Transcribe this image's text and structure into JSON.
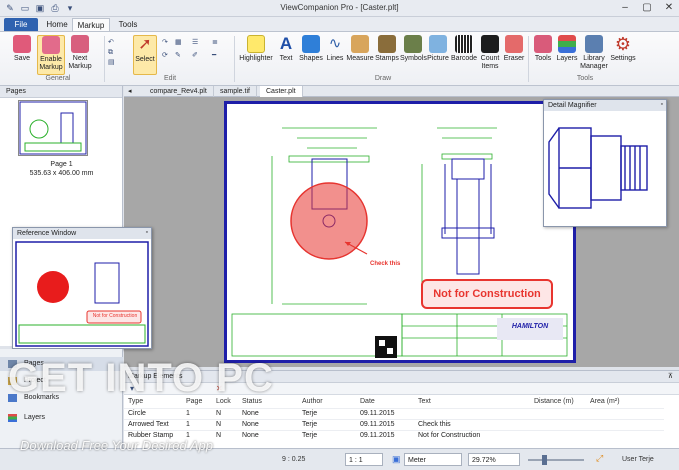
{
  "window": {
    "title": "ViewCompanion Pro - [Caster.plt]"
  },
  "tabs": {
    "file": "File",
    "home": "Home",
    "markup": "Markup",
    "tools": "Tools"
  },
  "ribbon": {
    "save": "Save",
    "enable_markup_1": "Enable",
    "enable_markup_2": "Markup",
    "next_markup_1": "Next",
    "next_markup_2": "Markup",
    "select": "Select",
    "highlighter": "Highlighter",
    "text": "Text",
    "shapes": "Shapes",
    "lines": "Lines",
    "measure": "Measure",
    "stamps": "Stamps",
    "symbols": "Symbols",
    "picture": "Picture",
    "barcode": "Barcode",
    "count_items_1": "Count",
    "count_items_2": "Items",
    "eraser": "Eraser",
    "tools": "Tools",
    "layers": "Layers",
    "library_manager_1": "Library",
    "library_manager_2": "Manager",
    "settings": "Settings",
    "group_general": "General",
    "group_edit": "Edit",
    "group_draw": "Draw",
    "group_tools": "Tools"
  },
  "pages_panel": {
    "title": "Pages",
    "page_label": "Page 1",
    "page_size": "535.63 x 406.00 mm"
  },
  "reference_window": {
    "title": "Reference Window",
    "stamp_text": "Not for Construction"
  },
  "doc_tabs": [
    "compare_Rev4.plt",
    "sample.tif",
    "Caster.plt"
  ],
  "drawing": {
    "annotation": "Check this",
    "stamp": "Not for Construction",
    "brand": "HAMILTON"
  },
  "detail_magnifier": {
    "title": "Detail Magnifier"
  },
  "left_nav": {
    "pages": "Pages",
    "project": "Project",
    "bookmarks": "Bookmarks",
    "layers": "Layers"
  },
  "markup_elements": {
    "title": "Markup Elements",
    "columns": [
      "Type",
      "Page",
      "Lock",
      "Status",
      "Author",
      "Date",
      "Text",
      "Distance (m)",
      "Area (m²)"
    ],
    "rows": [
      [
        "Circle",
        "1",
        "N",
        "None",
        "Terje",
        "09.11.2015",
        "",
        "",
        ""
      ],
      [
        "Arrowed Text",
        "1",
        "N",
        "None",
        "Terje",
        "09.11.2015",
        "Check this",
        "",
        ""
      ],
      [
        "Rubber Stamp",
        "1",
        "N",
        "None",
        "Terje",
        "09.11.2015",
        "Not for Construction",
        "",
        ""
      ]
    ]
  },
  "statusbar": {
    "coords": "9 : 0.25",
    "scale": "1 : 1",
    "unit": "Meter",
    "zoom": "29.72%",
    "user": "User Terje",
    "page_num": "1"
  },
  "watermark": {
    "main": "GET INTO PC",
    "sub": "Download Free Your Desired App"
  },
  "colors": {
    "accent": "#2f62b0",
    "drawing_green": "#2bb02b",
    "markup_red": "#e8352f",
    "sheet_border": "#1e1ea8"
  }
}
